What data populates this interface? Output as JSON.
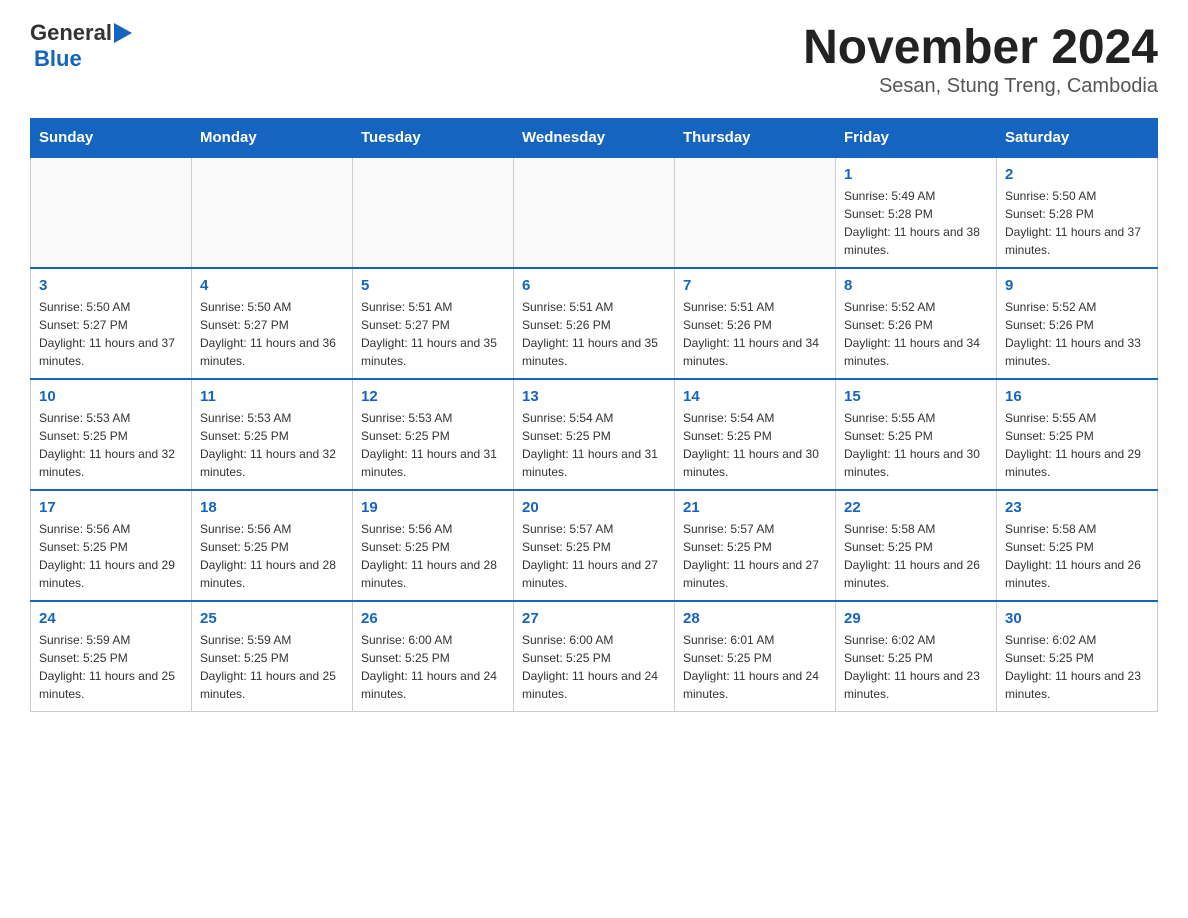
{
  "logo": {
    "general": "General",
    "arrow": "▶",
    "blue": "Blue"
  },
  "title": "November 2024",
  "subtitle": "Sesan, Stung Treng, Cambodia",
  "weekdays": [
    "Sunday",
    "Monday",
    "Tuesday",
    "Wednesday",
    "Thursday",
    "Friday",
    "Saturday"
  ],
  "weeks": [
    [
      {
        "day": "",
        "info": ""
      },
      {
        "day": "",
        "info": ""
      },
      {
        "day": "",
        "info": ""
      },
      {
        "day": "",
        "info": ""
      },
      {
        "day": "",
        "info": ""
      },
      {
        "day": "1",
        "info": "Sunrise: 5:49 AM\nSunset: 5:28 PM\nDaylight: 11 hours and 38 minutes."
      },
      {
        "day": "2",
        "info": "Sunrise: 5:50 AM\nSunset: 5:28 PM\nDaylight: 11 hours and 37 minutes."
      }
    ],
    [
      {
        "day": "3",
        "info": "Sunrise: 5:50 AM\nSunset: 5:27 PM\nDaylight: 11 hours and 37 minutes."
      },
      {
        "day": "4",
        "info": "Sunrise: 5:50 AM\nSunset: 5:27 PM\nDaylight: 11 hours and 36 minutes."
      },
      {
        "day": "5",
        "info": "Sunrise: 5:51 AM\nSunset: 5:27 PM\nDaylight: 11 hours and 35 minutes."
      },
      {
        "day": "6",
        "info": "Sunrise: 5:51 AM\nSunset: 5:26 PM\nDaylight: 11 hours and 35 minutes."
      },
      {
        "day": "7",
        "info": "Sunrise: 5:51 AM\nSunset: 5:26 PM\nDaylight: 11 hours and 34 minutes."
      },
      {
        "day": "8",
        "info": "Sunrise: 5:52 AM\nSunset: 5:26 PM\nDaylight: 11 hours and 34 minutes."
      },
      {
        "day": "9",
        "info": "Sunrise: 5:52 AM\nSunset: 5:26 PM\nDaylight: 11 hours and 33 minutes."
      }
    ],
    [
      {
        "day": "10",
        "info": "Sunrise: 5:53 AM\nSunset: 5:25 PM\nDaylight: 11 hours and 32 minutes."
      },
      {
        "day": "11",
        "info": "Sunrise: 5:53 AM\nSunset: 5:25 PM\nDaylight: 11 hours and 32 minutes."
      },
      {
        "day": "12",
        "info": "Sunrise: 5:53 AM\nSunset: 5:25 PM\nDaylight: 11 hours and 31 minutes."
      },
      {
        "day": "13",
        "info": "Sunrise: 5:54 AM\nSunset: 5:25 PM\nDaylight: 11 hours and 31 minutes."
      },
      {
        "day": "14",
        "info": "Sunrise: 5:54 AM\nSunset: 5:25 PM\nDaylight: 11 hours and 30 minutes."
      },
      {
        "day": "15",
        "info": "Sunrise: 5:55 AM\nSunset: 5:25 PM\nDaylight: 11 hours and 30 minutes."
      },
      {
        "day": "16",
        "info": "Sunrise: 5:55 AM\nSunset: 5:25 PM\nDaylight: 11 hours and 29 minutes."
      }
    ],
    [
      {
        "day": "17",
        "info": "Sunrise: 5:56 AM\nSunset: 5:25 PM\nDaylight: 11 hours and 29 minutes."
      },
      {
        "day": "18",
        "info": "Sunrise: 5:56 AM\nSunset: 5:25 PM\nDaylight: 11 hours and 28 minutes."
      },
      {
        "day": "19",
        "info": "Sunrise: 5:56 AM\nSunset: 5:25 PM\nDaylight: 11 hours and 28 minutes."
      },
      {
        "day": "20",
        "info": "Sunrise: 5:57 AM\nSunset: 5:25 PM\nDaylight: 11 hours and 27 minutes."
      },
      {
        "day": "21",
        "info": "Sunrise: 5:57 AM\nSunset: 5:25 PM\nDaylight: 11 hours and 27 minutes."
      },
      {
        "day": "22",
        "info": "Sunrise: 5:58 AM\nSunset: 5:25 PM\nDaylight: 11 hours and 26 minutes."
      },
      {
        "day": "23",
        "info": "Sunrise: 5:58 AM\nSunset: 5:25 PM\nDaylight: 11 hours and 26 minutes."
      }
    ],
    [
      {
        "day": "24",
        "info": "Sunrise: 5:59 AM\nSunset: 5:25 PM\nDaylight: 11 hours and 25 minutes."
      },
      {
        "day": "25",
        "info": "Sunrise: 5:59 AM\nSunset: 5:25 PM\nDaylight: 11 hours and 25 minutes."
      },
      {
        "day": "26",
        "info": "Sunrise: 6:00 AM\nSunset: 5:25 PM\nDaylight: 11 hours and 24 minutes."
      },
      {
        "day": "27",
        "info": "Sunrise: 6:00 AM\nSunset: 5:25 PM\nDaylight: 11 hours and 24 minutes."
      },
      {
        "day": "28",
        "info": "Sunrise: 6:01 AM\nSunset: 5:25 PM\nDaylight: 11 hours and 24 minutes."
      },
      {
        "day": "29",
        "info": "Sunrise: 6:02 AM\nSunset: 5:25 PM\nDaylight: 11 hours and 23 minutes."
      },
      {
        "day": "30",
        "info": "Sunrise: 6:02 AM\nSunset: 5:25 PM\nDaylight: 11 hours and 23 minutes."
      }
    ]
  ]
}
